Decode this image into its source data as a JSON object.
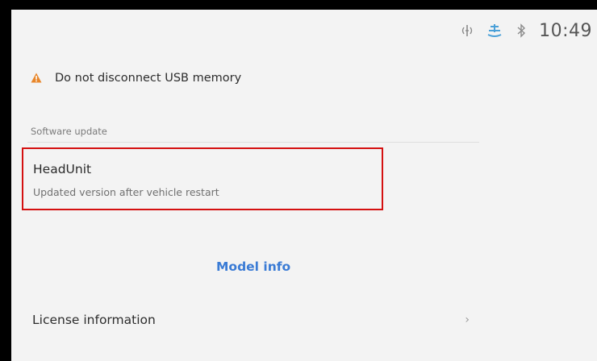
{
  "status_bar": {
    "icons": [
      "wireless-charging-icon",
      "climate-icon",
      "bluetooth-icon"
    ],
    "time": "10:49"
  },
  "warning": {
    "icon": "warning-icon",
    "text": "Do not disconnect USB memory",
    "color": "#e8862a"
  },
  "software_update": {
    "section_label": "Software update",
    "item": {
      "title": "HeadUnit",
      "subtitle": "Updated version after vehicle restart",
      "highlight_color": "#d41010"
    }
  },
  "model_info": {
    "label": "Model info",
    "color": "#3a7bd5"
  },
  "license": {
    "label": "License information",
    "chevron": "›"
  }
}
